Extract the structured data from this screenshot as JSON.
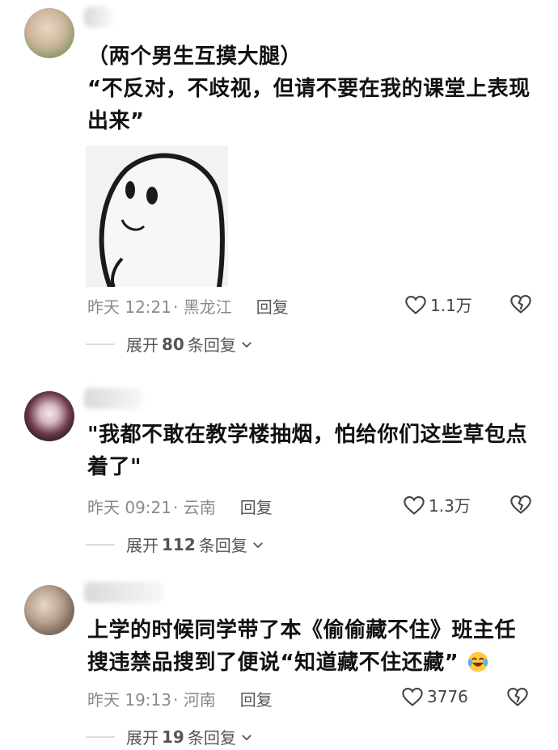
{
  "comments": [
    {
      "line1": "（两个男生互摸大腿）",
      "line2": "“不反对，不歧视，但请不要在我的课堂上表现",
      "line3": "出来”",
      "time": "昨天 12:21",
      "location": "· 黑龙江",
      "reply_label": "回复",
      "likes": "1.1万",
      "expand_prefix": "展开",
      "expand_count": "80",
      "expand_suffix": "条回复"
    },
    {
      "line1": "\"我都不敢在教学楼抽烟，怕给你们这些草包点",
      "line2": "着了\"",
      "time": "昨天 09:21",
      "location": "· 云南",
      "reply_label": "回复",
      "likes": "1.3万",
      "expand_prefix": "展开",
      "expand_count": "112",
      "expand_suffix": "条回复"
    },
    {
      "line1": "上学的时候同学带了本《偷偷藏不住》班主任",
      "line2": "搜违禁品搜到了便说“知道藏不住还藏”",
      "time": "昨天 19:13",
      "location": "· 河南",
      "reply_label": "回复",
      "likes": "3776",
      "expand_prefix": "展开",
      "expand_count": "19",
      "expand_suffix": "条回复"
    }
  ],
  "icons": {
    "like": "heart-outline-icon",
    "dislike": "broken-heart-icon",
    "expand": "chevron-down-icon",
    "emoji": "laughing-crying-emoji-icon"
  },
  "colors": {
    "meta_gray": "#8a8a8a",
    "text": "#111111"
  }
}
